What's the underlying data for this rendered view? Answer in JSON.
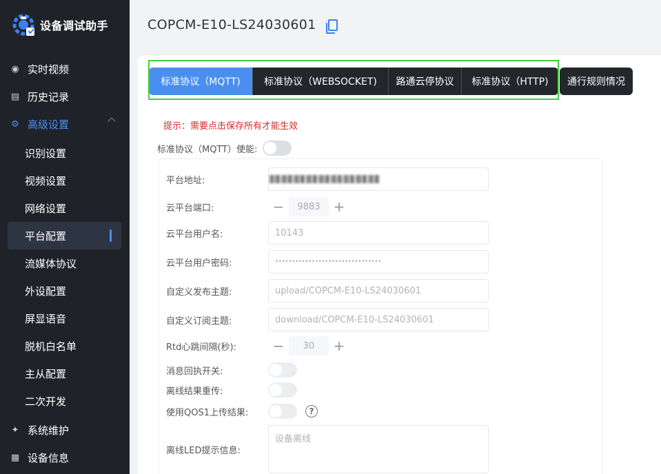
{
  "app": {
    "title": "设备调试助手"
  },
  "sidebar": {
    "items": [
      {
        "label": "实时视频",
        "icon": "video-icon"
      },
      {
        "label": "历史记录",
        "icon": "history-icon"
      },
      {
        "label": "高级设置",
        "icon": "gear-icon"
      }
    ],
    "sub_items": [
      "识别设置",
      "视频设置",
      "网络设置",
      "平台配置",
      "流媒体协议",
      "外设配置",
      "屏显语音",
      "脱机白名单",
      "主从配置",
      "二次开发"
    ],
    "bottom_items": [
      {
        "label": "系统维护",
        "icon": "tools-icon"
      },
      {
        "label": "设备信息",
        "icon": "info-icon"
      }
    ]
  },
  "header": {
    "device_id": "COPCM-E10-LS24030601"
  },
  "tabs": [
    "标准协议（MQTT)",
    "标准协议（WEBSOCKET)",
    "路通云停协议",
    "标准协议（HTTP)",
    "通行规则情况"
  ],
  "hint": "提示：需要点击保存所有才能生效",
  "form": {
    "enable_label": "标准协议（MQTT）使能:",
    "platform_address_label": "平台地址:",
    "port_label": "云平台端口:",
    "port_value": "9883",
    "username_label": "云平台用户名:",
    "username_value": "10143",
    "password_label": "云平台用户密码:",
    "password_value": "••••••••••••••••••••••••••••••••",
    "publish_topic_label": "自定义发布主题:",
    "publish_topic_value": "upload/COPCM-E10-LS24030601",
    "subscribe_topic_label": "自定义订阅主题:",
    "subscribe_topic_value": "download/COPCM-E10-LS24030601",
    "heartbeat_label": "Rtd心跳间隔(秒):",
    "heartbeat_value": "30",
    "ack_label": "消息回执开关:",
    "offline_resend_label": "离线结果重传:",
    "qos1_label": "使用QOS1上传结果:",
    "help_symbol": "?",
    "offline_led_label": "离线LED提示信息:",
    "offline_led_value": "设备离线",
    "minus": "−",
    "plus": "+"
  },
  "colors": {
    "accent": "#4a8ff0",
    "sidebar_bg": "#1f2329",
    "hint": "#d62b2b",
    "highlight": "#38d33d"
  }
}
